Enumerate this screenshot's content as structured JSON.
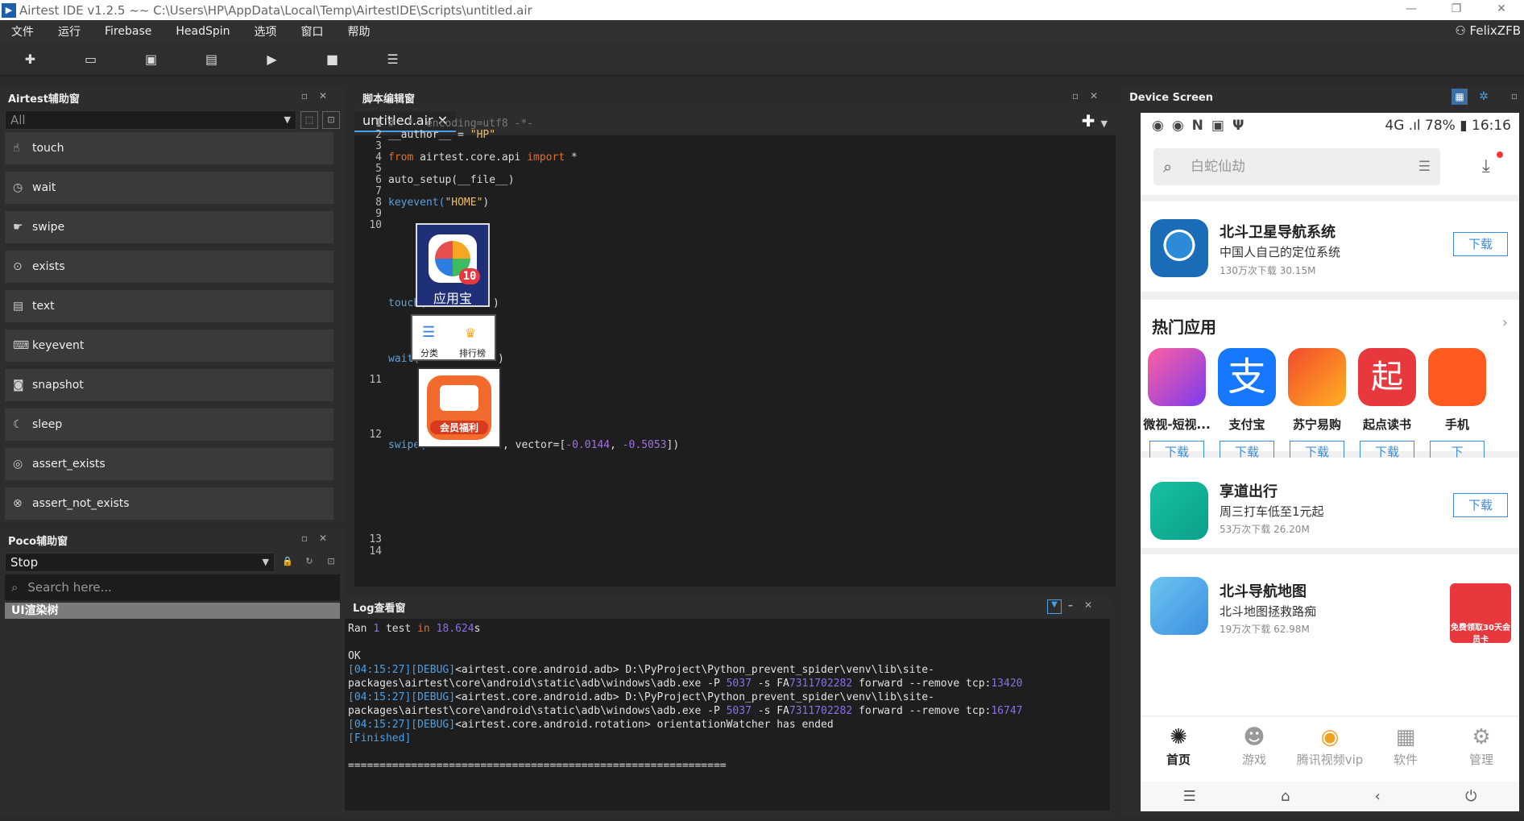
{
  "window": {
    "title": "Airtest IDE v1.2.5 ~~ C:\\Users\\HP\\AppData\\Local\\Temp\\AirtestIDE\\Scripts\\untitled.air",
    "minimize": "—",
    "maximize": "❐",
    "close": "✕"
  },
  "menu": {
    "items": [
      "文件",
      "运行",
      "Firebase",
      "HeadSpin",
      "选项",
      "窗口",
      "帮助"
    ],
    "user": "FelixZFB"
  },
  "toolbar": {
    "icons": [
      "new-file-icon",
      "open-folder-icon",
      "save-icon",
      "save-as-icon",
      "run-icon",
      "stop-icon",
      "log-icon"
    ]
  },
  "airtest_panel": {
    "title": "Airtest辅助窗",
    "filter_value": "All",
    "api_items": [
      "touch",
      "wait",
      "swipe",
      "exists",
      "text",
      "keyevent",
      "snapshot",
      "sleep",
      "assert_exists",
      "assert_not_exists"
    ]
  },
  "poco_panel": {
    "title": "Poco辅助窗",
    "mode_value": "Stop",
    "search_placeholder": "Search here...",
    "tree_root": "UI渲染树"
  },
  "editor": {
    "title": "脚本编辑窗",
    "tab_label": "untitled.air",
    "tab_close": "✕",
    "line_numbers": [
      "1",
      "2",
      "3",
      "4",
      "5",
      "6",
      "7",
      "8",
      "9",
      "10",
      "11",
      "12",
      "13",
      "14"
    ],
    "lines": {
      "l1": "# -*- encoding=utf8 -*-",
      "l2_a": "__author__ = ",
      "l2_b": "\"HP\"",
      "l4_a": "from",
      "l4_b": " airtest.core.api ",
      "l4_c": "import",
      "l4_d": " *",
      "l6": "auto_setup(__file__)",
      "l8_a": "keyevent(",
      "l8_b": "\"HOME\"",
      "l8_c": ")",
      "l10_a": "touch(",
      "l10_b": ")",
      "l11_a": "wait(",
      "l11_b": ")",
      "l12_a": "swipe(",
      "l12_b": ", vector=[",
      "l12_c": "-0.0144",
      "l12_d": ", ",
      "l12_e": "-0.5053",
      "l12_f": "])"
    },
    "thumb_touch_label": "应用宝",
    "thumb_touch_badge": "10",
    "thumb_wait_labels": [
      "分类",
      "排行榜"
    ],
    "thumb_swipe_label": "会员福利"
  },
  "log": {
    "title": "Log查看窗",
    "ran_a": "Ran ",
    "ran_b": "1",
    "ran_c": " test ",
    "ran_d": "in",
    "ran_e": " ",
    "ran_f": "18.624",
    "ran_g": "s",
    "ok": "OK",
    "l1_tag": "[04:15:27][DEBUG]",
    "l1_text": "<airtest.core.android.adb> D:\\PyProject\\Python_prevent_spider\\venv\\lib\\site-",
    "l2_a": "packages\\airtest\\core\\android\\static\\adb\\windows\\adb.exe -P ",
    "l2_b": "5037",
    "l2_c": " -s FA",
    "l2_d": "7311702282",
    "l2_e": " forward --remove tcp:",
    "l2_f": "13420",
    "l3_tag": "[04:15:27][DEBUG]",
    "l3_text": "<airtest.core.android.adb> D:\\PyProject\\Python_prevent_spider\\venv\\lib\\site-",
    "l4_a": "packages\\airtest\\core\\android\\static\\adb\\windows\\adb.exe -P ",
    "l4_b": "5037",
    "l4_c": " -s FA",
    "l4_d": "7311702282",
    "l4_e": " forward --remove tcp:",
    "l4_f": "16747",
    "l5_tag": "[04:15:27][DEBUG]",
    "l5_text": "<airtest.core.android.rotation> orientationWatcher has ended",
    "finished": "[Finished]",
    "separator": "============================================================"
  },
  "device": {
    "title": "Device Screen",
    "status_right": "4G .ıl 78% ▮ 16:16",
    "search_placeholder": "白蛇仙劫",
    "featured1": {
      "name": "北斗卫星导航系统",
      "desc": "中国人自己的定位系统",
      "meta": "130万次下载   30.15M",
      "button": "下载"
    },
    "hot_title": "热门应用",
    "hot_apps": [
      {
        "name": "微视-短视...",
        "button": "下载",
        "color": "#e8407a"
      },
      {
        "name": "支付宝",
        "button": "下载",
        "color": "#1677ff"
      },
      {
        "name": "苏宁易购",
        "button": "下载",
        "color": "#f24a2c"
      },
      {
        "name": "起点读书",
        "button": "下载",
        "color": "#e8383d"
      },
      {
        "name": "手机",
        "button": "下",
        "color": "#ff5a1f"
      }
    ],
    "featured2": {
      "name": "享道出行",
      "desc": "周三打车低至1元起",
      "meta": "53万次下载   26.20M",
      "button": "下载"
    },
    "featured3": {
      "name": "北斗导航地图",
      "desc": "北斗地图拯救路痴",
      "meta": "19万次下载   62.98M"
    },
    "ad_text": "免费领取30天会员卡",
    "nav": [
      "首页",
      "游戏",
      "腾讯视频vip",
      "软件",
      "管理"
    ]
  },
  "colors": {
    "accent": "#4aa0e6",
    "keyword": "#e07030",
    "string": "#f0c060",
    "number": "#a070e0",
    "download_blue": "#3b8be0"
  }
}
